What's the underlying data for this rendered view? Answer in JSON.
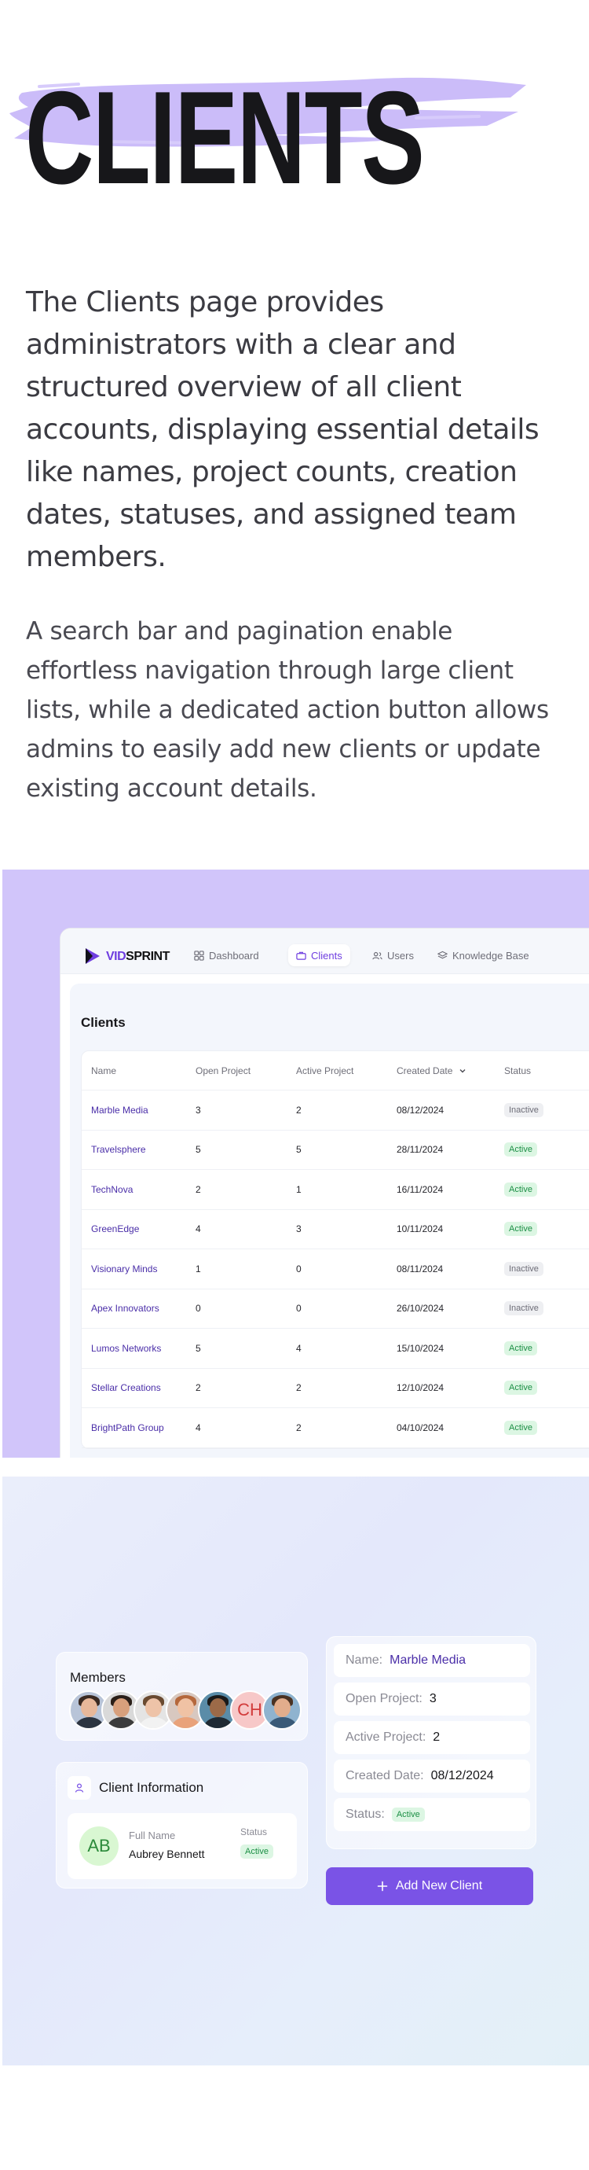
{
  "hero": {
    "title": "CLIENTS",
    "paragraph_1": "The Clients page provides administrators with a clear and structured overview of all client accounts, displaying essential details like names, project counts, creation dates, statuses, and assigned team members.",
    "paragraph_2": "A search bar and pagination enable effortless navigation through large client lists, while a dedicated action button allows admins to easily add new clients or update existing account details.",
    "brush_color": "#cbbcf9"
  },
  "app": {
    "logo_prefix": "VID",
    "logo_suffix": "SPRINT",
    "nav": [
      {
        "label": "Dashboard",
        "icon": "grid-icon"
      },
      {
        "label": "Clients",
        "icon": "briefcase-icon",
        "active": true
      },
      {
        "label": "Users",
        "icon": "users-icon"
      },
      {
        "label": "Knowledge Base",
        "icon": "layers-icon"
      }
    ],
    "page_title": "Clients",
    "columns": [
      "Name",
      "Open Project",
      "Active Project",
      "Created Date",
      "Status"
    ],
    "rows": [
      {
        "name": "Marble Media",
        "open": "3",
        "active": "2",
        "date": "08/12/2024",
        "status": "Inactive"
      },
      {
        "name": "Travelsphere",
        "open": "5",
        "active": "5",
        "date": "28/11/2024",
        "status": "Active"
      },
      {
        "name": "TechNova",
        "open": "2",
        "active": "1",
        "date": "16/11/2024",
        "status": "Active"
      },
      {
        "name": "GreenEdge",
        "open": "4",
        "active": "3",
        "date": "10/11/2024",
        "status": "Active"
      },
      {
        "name": "Visionary Minds",
        "open": "1",
        "active": "0",
        "date": "08/11/2024",
        "status": "Inactive"
      },
      {
        "name": "Apex Innovators",
        "open": "0",
        "active": "0",
        "date": "26/10/2024",
        "status": "Inactive"
      },
      {
        "name": "Lumos Networks",
        "open": "5",
        "active": "4",
        "date": "15/10/2024",
        "status": "Active"
      },
      {
        "name": "Stellar Creations",
        "open": "2",
        "active": "2",
        "date": "12/10/2024",
        "status": "Active"
      },
      {
        "name": "BrightPath Group",
        "open": "4",
        "active": "2",
        "date": "04/10/2024",
        "status": "Active"
      }
    ],
    "colors": {
      "accent": "#6f3ee0",
      "section_bg": "#d1c5fa"
    }
  },
  "detail": {
    "members_title": "Members",
    "member_initials": "CH",
    "client_info_title": "Client Information",
    "full_name_label": "Full Name",
    "full_name": "Aubrey Bennett",
    "avatar_initials": "AB",
    "status_label": "Status",
    "status_value": "Active",
    "fields": {
      "name_label": "Name:",
      "name_value": "Marble Media",
      "open_label": "Open Project:",
      "open_value": "3",
      "active_label": "Active Project:",
      "active_value": "2",
      "created_label": "Created Date:",
      "created_value": "08/12/2024",
      "status_label": "Status:",
      "status_value": "Active"
    },
    "add_button": "Add New Client",
    "button_color": "#7a53e6"
  }
}
